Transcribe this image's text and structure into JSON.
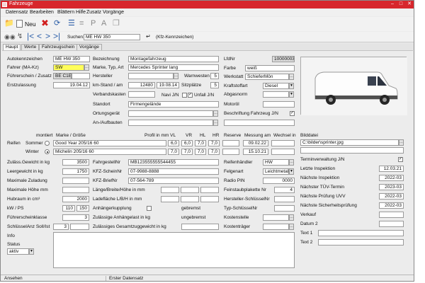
{
  "window": {
    "title": "Fahrzeuge"
  },
  "menu": [
    "Datensatz",
    "Bearbeiten",
    "Blättern",
    "Hilfe",
    "Zusatz",
    "Vorgänge"
  ],
  "toolbar": {
    "new_label": "Neu"
  },
  "nav": {
    "search_label": "Suchen:",
    "search_value": "ME HW 350",
    "search_hint": "(Kfz-Kennzeichen)"
  },
  "tabs": [
    "Haupt",
    "Werte",
    "Fahrzeugschein",
    "Vorgänge"
  ],
  "main": {
    "autokennzeichen_label": "Autokennzeichen",
    "autokennzeichen": "ME HW 350",
    "fahrer_label": "Fahrer (MA-Kz)",
    "fahrer": "SW",
    "fuehrerschein_label": "Führerschein / Zusatz",
    "fuehrerschein": "BE C1E",
    "erstzulassung_label": "Erstzulassung",
    "erstzulassung": "19.04.12",
    "bezeichnung_label": "Bezeichnung",
    "bezeichnung": "Montagefahrzeug",
    "marke_label": "Marke, Typ, Art",
    "marke": "Mercedes Sprinter lang",
    "hersteller_label": "Hersteller",
    "hersteller": "",
    "kmstand_label": "km-Stand / am",
    "kmstand": "12480",
    "kmstand_datum": "19.08.14",
    "verbandskasten_label": "Verbandskasten",
    "warnwesten_label": "Warnwesten",
    "warnwesten": "5",
    "sitzplaetze_label": "Sitzplätze",
    "sitzplaetze": "5",
    "navi_label": "Navi J/N",
    "unfall_label": "Unfall J/N",
    "lfdnr_label": "LfdNr",
    "lfdnr": "10000003",
    "farbe_label": "Farbe",
    "farbe": "weiß",
    "werkstatt_label": "Werkstatt",
    "werkstatt": "SchieferMön",
    "kraftstoff_label": "Kraftstoffart",
    "kraftstoff": "Diesel",
    "abgasnorm_label": "Abgasnorm",
    "standort_label": "Standort",
    "standort": "Firmengelände",
    "motoroel_label": "Motoröl",
    "ortungsgeraet_label": "Ortungsgerät",
    "beschriftung_label": "Beschriftung Fahrzeug J/N",
    "aufbauten_label": "An-/Aufbauten"
  },
  "reifen": {
    "montiert_label": "montiert",
    "marke_groesse_label": "Marke / Größe",
    "profil_label": "Profil in mm VL",
    "vr_label": "VR",
    "hl_label": "HL",
    "hr_label": "HR",
    "reserve_label": "Reserve",
    "messung_label": "Messung am",
    "wechsel_label": "Wechsel in",
    "reifen_label": "Reifen",
    "rows": [
      {
        "name": "Sommer",
        "marke": "Good Year 205/16 60",
        "vl": "6,0",
        "vr": "6,0",
        "hl": "7,0",
        "hr": "7,0",
        "reserve": "",
        "messung": "09.02.22",
        "wechsel": ""
      },
      {
        "name": "Winter",
        "marke": "Michelin 205/16 60",
        "vl": "7,0",
        "vr": "7,0",
        "hl": "7,0",
        "hr": "7,0",
        "reserve": "",
        "messung": "15.10.21",
        "wechsel": ""
      }
    ]
  },
  "bilddatei": {
    "label": "Bilddatei",
    "value": "C:\\bilder\\sprinter.jpg"
  },
  "termin": {
    "verwaltung_label": "Terminverwaltung J/N",
    "items": [
      {
        "label": "Letzte Inspektion",
        "value": "12.03.21"
      },
      {
        "label": "Nächste Inspektion",
        "value": "2022-03"
      },
      {
        "label": "Nächster TÜV-Termin",
        "value": "2023-03"
      },
      {
        "label": "Nächste Prüfung UVV",
        "value": "2022-03"
      },
      {
        "label": "Nächste Sicherheitsprüfung",
        "value": "2022-03"
      },
      {
        "label": "Verkauf",
        "value": ""
      },
      {
        "label": "Datum 2",
        "value": ""
      },
      {
        "label": "Text 1",
        "value": ""
      },
      {
        "label": "Text 2",
        "value": ""
      }
    ]
  },
  "lower": {
    "gewicht_label": "Zuläss.Gewicht in kg",
    "gewicht": "3500",
    "leergewicht_label": "Leergewicht in kg",
    "leergewicht": "1750",
    "zuladung_label": "Maximale Zuladung",
    "zuladung": "",
    "hoehe_label": "Maximale Höhe mm",
    "hoehe": "",
    "hubraum_label": "Hubraum in cm³",
    "hubraum": "2000",
    "kwps_label": "kW / PS",
    "kw": "110",
    "ps": "150",
    "fsklasse_label": "Führerscheinklasse",
    "fsklasse": "3",
    "schluessel_label": "SchlüsselAnz Soll/Ist",
    "schluessel_soll": "3",
    "schluessel_ist": "",
    "info_label": "Info",
    "status_label": "Status",
    "status": "aktiv",
    "fahrgestell_label": "FahrgestellNr",
    "fahrgestell": "MB123555555544455",
    "kfzschein_label": "KFZ-ScheinNr",
    "kfzschein": "07-9988-8888",
    "kfzbrief_label": "KFZ-BriefNr",
    "kfzbrief": "07-564-789",
    "laenge_label": "Länge/Breite/Höhe in mm",
    "ladeflaeche_label": "Ladefläche L/B/H in mm",
    "anhaenger_label": "Anhängerkupplung",
    "gebremst_label": "gebremst",
    "anhaengelast_label": "Zulässige Anhängelast in kg",
    "ungebremst_label": "ungebremst",
    "gesamtzug_label": "Zulässiges Gesamtzuggewicht in kg",
    "reifenhaendler_label": "Reifenhändler",
    "reifenhaendler": "HW",
    "felgenart_label": "Felgenart",
    "felgenart": "Leichtmetall",
    "radiopin_label": "Radio PIN",
    "radiopin": "0000",
    "feinstaub_label": "Feinstaubplakette Nr",
    "feinstaub": "4",
    "herstellerschl_label": "Hersteller-SchlüsselNr",
    "typschl_label": "Typ-SchlüsselNr",
    "kostenstelle_label": "Kostenstelle",
    "kostentraeger_label": "Kostenträger"
  },
  "status": {
    "left": "Ansehen",
    "right": "Erster Datensatz"
  }
}
